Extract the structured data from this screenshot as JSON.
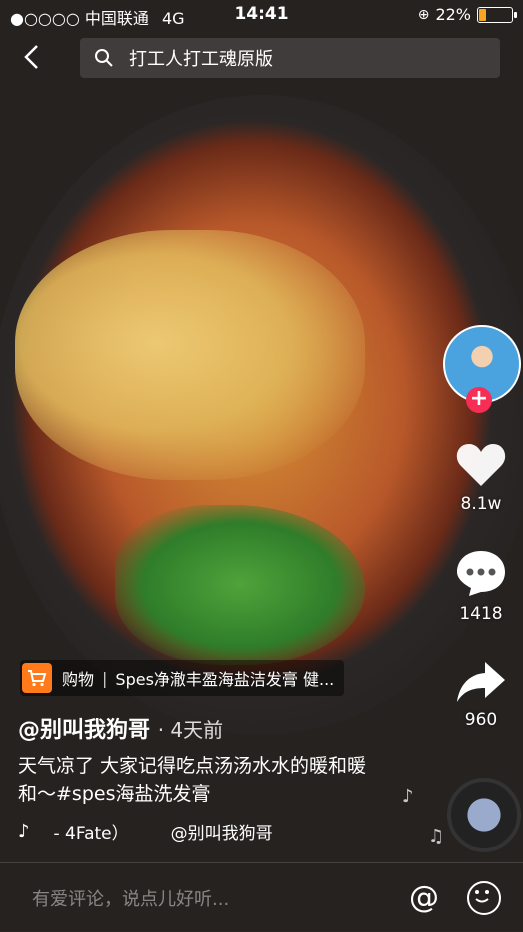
{
  "status_bar": {
    "carrier": "●○○○○ 中国联通",
    "network": "4G",
    "time": "14:41",
    "battery_text": "22%",
    "battery_level": 0.22
  },
  "search": {
    "query": "打工人打工魂原版"
  },
  "sidebar": {
    "likes": "8.1w",
    "comments": "1418",
    "shares": "960"
  },
  "shopping": {
    "label": "购物",
    "separator": "|",
    "product": "Spes净澈丰盈海盐洁发膏 健..."
  },
  "post": {
    "author": "@别叫我狗哥",
    "age": "· 4天前",
    "description": "天气凉了  大家记得吃点汤汤水水的暖和暖和～#spes海盐洗发膏"
  },
  "music": {
    "song": "- 4Fate）",
    "singer": "@别叫我狗哥"
  },
  "comment_bar": {
    "placeholder": "有爱评论，说点儿好听..."
  },
  "colors": {
    "accent_red": "#f62d55",
    "shop_orange": "#ff7a1a"
  }
}
